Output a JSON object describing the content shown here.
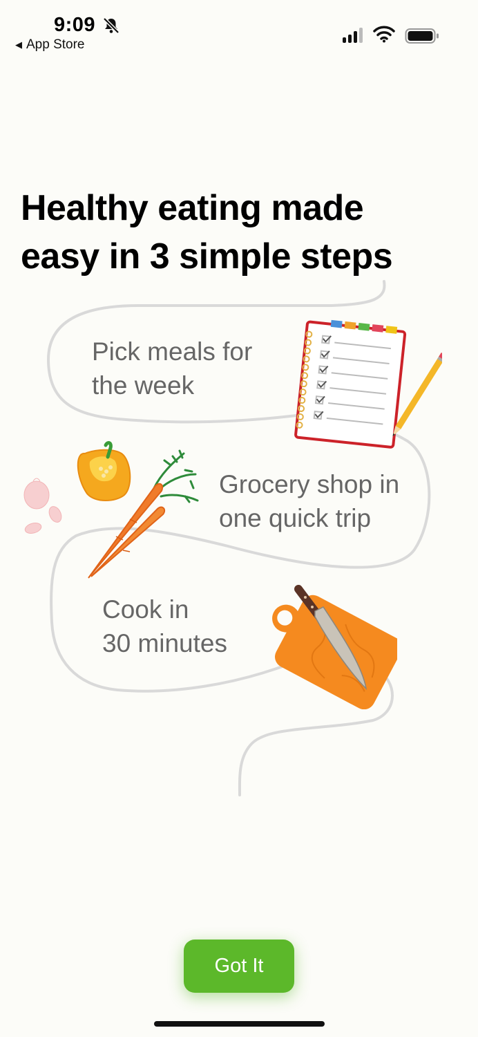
{
  "status_bar": {
    "time": "9:09",
    "back_label": "App Store",
    "icons": [
      "bell-slash-icon",
      "cellular-signal-icon",
      "wifi-icon",
      "battery-icon"
    ]
  },
  "headline": {
    "line1": "Healthy eating made",
    "line2": "easy in 3 simple steps"
  },
  "steps": [
    {
      "line1": "Pick meals for",
      "line2": "the week",
      "icon": "notepad-pencil-illustration"
    },
    {
      "line1": "Grocery shop in",
      "line2": "one quick trip",
      "icon": "vegetables-illustration"
    },
    {
      "line1": "Cook in",
      "line2": "30 minutes",
      "icon": "cutting-board-knife-illustration"
    }
  ],
  "cta": {
    "label": "Got It"
  },
  "colors": {
    "accent": "#5cb82a",
    "background": "#fcfcf8",
    "path": "#d9d9d9",
    "step_text": "#666666"
  }
}
